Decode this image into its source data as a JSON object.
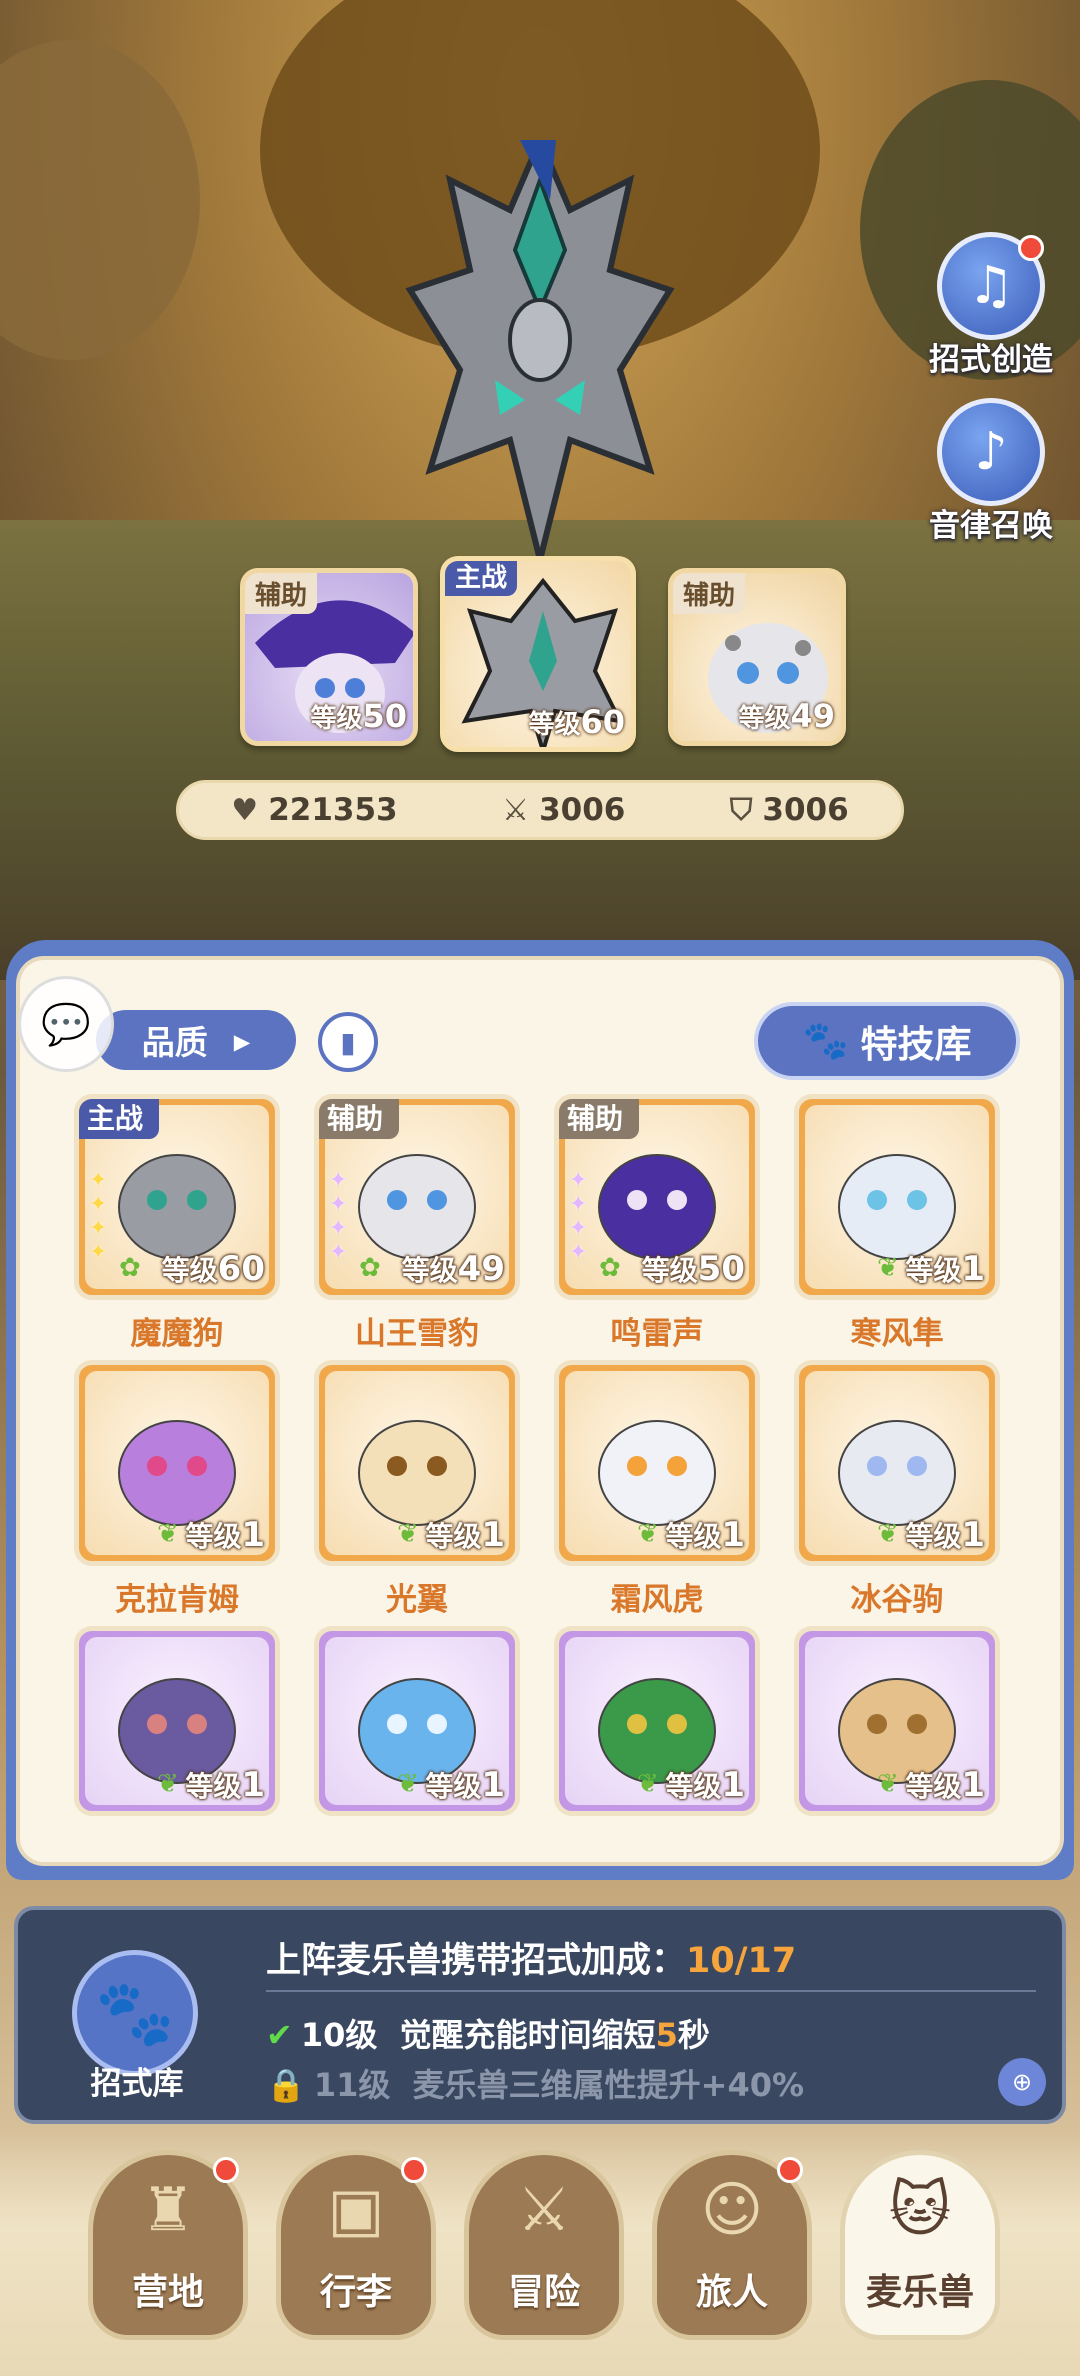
{
  "side_buttons": [
    {
      "label": "招式创造",
      "icon": "music-book-icon",
      "has_dot": true
    },
    {
      "label": "音律召唤",
      "icon": "lyre-icon",
      "has_dot": false
    }
  ],
  "lineup": [
    {
      "tag": "辅助",
      "level_prefix": "等级",
      "level": "50"
    },
    {
      "tag": "主战",
      "level_prefix": "等级",
      "level": "60"
    },
    {
      "tag": "辅助",
      "level_prefix": "等级",
      "level": "49"
    }
  ],
  "stats": {
    "hp": "221353",
    "attack": "3006",
    "defense": "3006"
  },
  "toolbar": {
    "quality_label": "品质",
    "skill_library_label": "特技库"
  },
  "pets": [
    {
      "name": "魔魔狗",
      "tag": "主战",
      "level_prefix": "等级",
      "level": "60",
      "rarity": "gold"
    },
    {
      "name": "山王雪豹",
      "tag": "辅助",
      "level_prefix": "等级",
      "level": "49",
      "rarity": "gold"
    },
    {
      "name": "鸣雷声",
      "tag": "辅助",
      "level_prefix": "等级",
      "level": "50",
      "rarity": "gold"
    },
    {
      "name": "寒风隼",
      "tag": "",
      "level_prefix": "等级",
      "level": "1",
      "rarity": "gold"
    },
    {
      "name": "克拉肯姆",
      "tag": "",
      "level_prefix": "等级",
      "level": "1",
      "rarity": "gold"
    },
    {
      "name": "光翼",
      "tag": "",
      "level_prefix": "等级",
      "level": "1",
      "rarity": "gold"
    },
    {
      "name": "霜风虎",
      "tag": "",
      "level_prefix": "等级",
      "level": "1",
      "rarity": "gold"
    },
    {
      "name": "冰谷驹",
      "tag": "",
      "level_prefix": "等级",
      "level": "1",
      "rarity": "gold"
    },
    {
      "name": "",
      "tag": "",
      "level_prefix": "等级",
      "level": "1",
      "rarity": "purple"
    },
    {
      "name": "",
      "tag": "",
      "level_prefix": "等级",
      "level": "1",
      "rarity": "purple"
    },
    {
      "name": "",
      "tag": "",
      "level_prefix": "等级",
      "level": "1",
      "rarity": "purple"
    },
    {
      "name": "",
      "tag": "",
      "level_prefix": "等级",
      "level": "1",
      "rarity": "purple"
    }
  ],
  "bonus_panel": {
    "icon_label": "招式库",
    "title": "上阵麦乐兽携带招式加成：",
    "progress": "10/17",
    "row1_level": "10级",
    "row1_text": "觉醒充能时间缩短",
    "row1_value": "5",
    "row1_unit": "秒",
    "row2_level": "11级",
    "row2_text": "麦乐兽三维属性提升+40%"
  },
  "nav": [
    {
      "label": "营地",
      "icon": "castle-icon",
      "has_dot": true,
      "active": false
    },
    {
      "label": "行李",
      "icon": "chest-icon",
      "has_dot": true,
      "active": false
    },
    {
      "label": "冒险",
      "icon": "swords-icon",
      "has_dot": false,
      "active": false
    },
    {
      "label": "旅人",
      "icon": "traveler-icon",
      "has_dot": true,
      "active": false
    },
    {
      "label": "麦乐兽",
      "icon": "pet-icon",
      "has_dot": false,
      "active": true
    }
  ]
}
